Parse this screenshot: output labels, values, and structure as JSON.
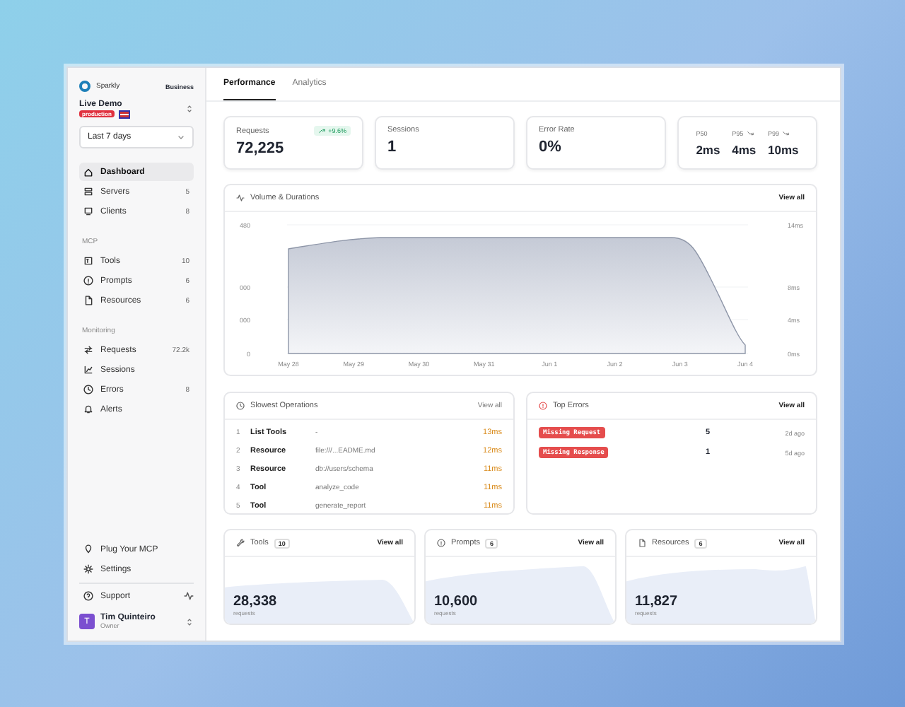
{
  "brand": {
    "name": "Sparkly",
    "plan": "Business"
  },
  "project": {
    "name": "Live Demo",
    "env": "production"
  },
  "range": {
    "value": "Last 7 days"
  },
  "nav": [
    {
      "items": [
        {
          "label": "Dashboard",
          "selected": true
        },
        {
          "label": "Servers",
          "count": "5",
          "selected": false
        },
        {
          "label": "Clients",
          "count": "8",
          "selected": false
        }
      ]
    },
    {
      "title": "MCP",
      "items": [
        {
          "label": "Tools",
          "count": "10",
          "selected": false
        },
        {
          "label": "Prompts",
          "count": "6",
          "selected": false
        },
        {
          "label": "Resources",
          "count": "6",
          "selected": false
        }
      ]
    },
    {
      "title": "Monitoring",
      "items": [
        {
          "label": "Requests",
          "count": "72.2k",
          "selected": false
        },
        {
          "label": "Sessions",
          "selected": false
        },
        {
          "label": "Errors",
          "count": "8",
          "selected": false
        },
        {
          "label": "Alerts",
          "selected": false
        }
      ]
    }
  ],
  "footer_links": [
    {
      "label": "Plug Your MCP"
    },
    {
      "label": "Settings"
    }
  ],
  "support": {
    "label": "Support"
  },
  "user": {
    "initial": "T",
    "name": "Tim Quinteiro",
    "role": "Owner"
  },
  "tabs": [
    {
      "label": "Performance",
      "selected": true
    },
    {
      "label": "Analytics",
      "selected": false
    }
  ],
  "stats": [
    {
      "kind": "single",
      "label": "Requests",
      "value": "72,225",
      "trend": "+9.6%"
    },
    {
      "kind": "single",
      "label": "Sessions",
      "value": "1"
    },
    {
      "kind": "single",
      "label": "Error Rate",
      "value": "0%"
    },
    {
      "kind": "latency",
      "metrics": [
        {
          "label": "P50",
          "value": "2ms",
          "falling": false
        },
        {
          "label": "P95",
          "value": "4ms",
          "falling": true
        },
        {
          "label": "P99",
          "value": "10ms",
          "falling": true
        }
      ]
    }
  ],
  "chart": {
    "title": "Volume & Durations",
    "action": "View all",
    "left_ticks": [
      "480",
      "000",
      "000",
      "0"
    ],
    "right_ticks": [
      "14ms",
      "8ms",
      "4ms",
      "0ms"
    ],
    "dates": [
      "May 28",
      "May 29",
      "May 30",
      "May 31",
      "Jun 1",
      "Jun 2",
      "Jun 3",
      "Jun 4"
    ]
  },
  "slowest": {
    "title": "Slowest Operations",
    "action": "View all",
    "rows": [
      {
        "rank": "1",
        "type": "List Tools",
        "target": "-",
        "duration": "13ms"
      },
      {
        "rank": "2",
        "type": "Resource",
        "target": "file:///...EADME.md",
        "duration": "12ms"
      },
      {
        "rank": "3",
        "type": "Resource",
        "target": "db://users/schema",
        "duration": "11ms"
      },
      {
        "rank": "4",
        "type": "Tool",
        "target": "analyze_code",
        "duration": "11ms"
      },
      {
        "rank": "5",
        "type": "Tool",
        "target": "generate_report",
        "duration": "11ms"
      }
    ]
  },
  "errors": {
    "title": "Top Errors",
    "action": "View all",
    "rows": [
      {
        "name": "Missing Request",
        "count": "5",
        "age": "2d ago"
      },
      {
        "name": "Missing Response",
        "count": "1",
        "age": "5d ago"
      }
    ]
  },
  "summaries": [
    {
      "title": "Tools",
      "count": "10",
      "action": "View all",
      "value": "28,338",
      "unit": "requests"
    },
    {
      "title": "Prompts",
      "count": "6",
      "action": "View all",
      "value": "10,600",
      "unit": "requests"
    },
    {
      "title": "Resources",
      "count": "6",
      "action": "View all",
      "value": "11,827",
      "unit": "requests"
    }
  ]
}
